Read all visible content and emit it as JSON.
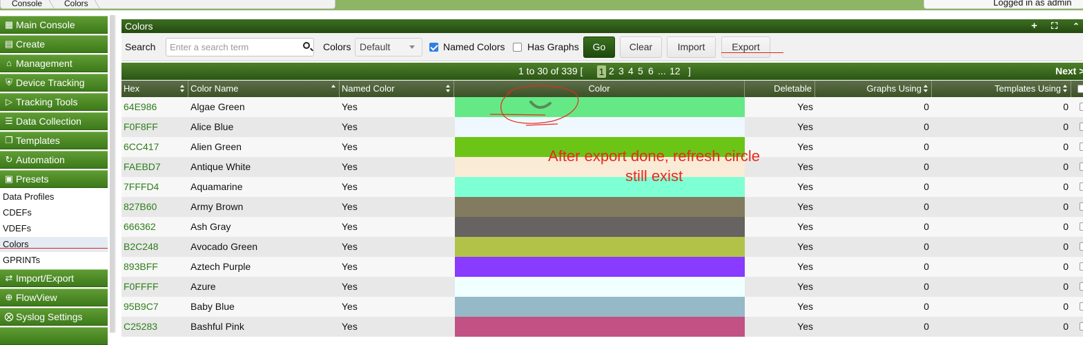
{
  "breadcrumb": [
    "Console",
    "Colors"
  ],
  "login_text": "Logged in as admin",
  "sidebar": {
    "nav_items": [
      {
        "label": "Main Console",
        "icon": "map-icon"
      },
      {
        "label": "Create",
        "icon": "chart-icon"
      },
      {
        "label": "Management",
        "icon": "home-icon"
      },
      {
        "label": "Device Tracking",
        "icon": "shield-icon"
      },
      {
        "label": "Tracking Tools",
        "icon": "bullhorn-icon"
      },
      {
        "label": "Data Collection",
        "icon": "database-icon"
      },
      {
        "label": "Templates",
        "icon": "copy-icon"
      },
      {
        "label": "Automation",
        "icon": "refresh-icon"
      },
      {
        "label": "Presets",
        "icon": "archive-icon"
      }
    ],
    "sub_items": [
      "Data Profiles",
      "CDEFs",
      "VDEFs",
      "Colors",
      "GPRINTs"
    ],
    "nav_items_bottom": [
      {
        "label": "Import/Export",
        "icon": "exchange-icon"
      },
      {
        "label": "FlowView",
        "icon": "crosshair-icon"
      },
      {
        "label": "Syslog Settings",
        "icon": "settings-icon"
      }
    ]
  },
  "panel": {
    "title": "Colors",
    "filter": {
      "search_label": "Search",
      "search_placeholder": "Enter a search term",
      "colors_label": "Colors",
      "colors_value": "Default",
      "named_colors_label": "Named Colors",
      "named_colors_checked": true,
      "has_graphs_label": "Has Graphs",
      "has_graphs_checked": false,
      "go_label": "Go",
      "clear_label": "Clear",
      "import_label": "Import",
      "export_label": "Export"
    },
    "pager": {
      "range_text": "1 to 30 of 339 [",
      "current_page": "1",
      "pages": [
        "2",
        "3",
        "4",
        "5",
        "6"
      ],
      "ellipsis": "...",
      "last_page": "12",
      "close_bracket": "]",
      "next_label": "Next >"
    },
    "columns": [
      "Hex",
      "Color Name",
      "Named Color",
      "Color",
      "Deletable",
      "Graphs Using",
      "Templates Using"
    ],
    "rows": [
      {
        "hex": "64E986",
        "name": "Algae Green",
        "named": "Yes",
        "color": "#64E986",
        "deletable": "Yes",
        "graphs": "0",
        "templates": "0"
      },
      {
        "hex": "F0F8FF",
        "name": "Alice Blue",
        "named": "Yes",
        "color": "#F0F8FF",
        "deletable": "Yes",
        "graphs": "0",
        "templates": "0"
      },
      {
        "hex": "6CC417",
        "name": "Alien Green",
        "named": "Yes",
        "color": "#6CC417",
        "deletable": "Yes",
        "graphs": "0",
        "templates": "0"
      },
      {
        "hex": "FAEBD7",
        "name": "Antique White",
        "named": "Yes",
        "color": "#FAEBD7",
        "deletable": "Yes",
        "graphs": "0",
        "templates": "0"
      },
      {
        "hex": "7FFFD4",
        "name": "Aquamarine",
        "named": "Yes",
        "color": "#7FFFD4",
        "deletable": "Yes",
        "graphs": "0",
        "templates": "0"
      },
      {
        "hex": "827B60",
        "name": "Army Brown",
        "named": "Yes",
        "color": "#827B60",
        "deletable": "Yes",
        "graphs": "0",
        "templates": "0"
      },
      {
        "hex": "666362",
        "name": "Ash Gray",
        "named": "Yes",
        "color": "#666362",
        "deletable": "Yes",
        "graphs": "0",
        "templates": "0"
      },
      {
        "hex": "B2C248",
        "name": "Avocado Green",
        "named": "Yes",
        "color": "#B2C248",
        "deletable": "Yes",
        "graphs": "0",
        "templates": "0"
      },
      {
        "hex": "893BFF",
        "name": "Aztech Purple",
        "named": "Yes",
        "color": "#893BFF",
        "deletable": "Yes",
        "graphs": "0",
        "templates": "0"
      },
      {
        "hex": "F0FFFF",
        "name": "Azure",
        "named": "Yes",
        "color": "#F0FFFF",
        "deletable": "Yes",
        "graphs": "0",
        "templates": "0"
      },
      {
        "hex": "95B9C7",
        "name": "Baby Blue",
        "named": "Yes",
        "color": "#95B9C7",
        "deletable": "Yes",
        "graphs": "0",
        "templates": "0"
      },
      {
        "hex": "C25283",
        "name": "Bashful Pink",
        "named": "Yes",
        "color": "#C25283",
        "deletable": "Yes",
        "graphs": "0",
        "templates": "0"
      }
    ]
  },
  "annotation": {
    "line1": "After export done, refresh circle",
    "line2": "still exist",
    "color": "#e8291c"
  }
}
